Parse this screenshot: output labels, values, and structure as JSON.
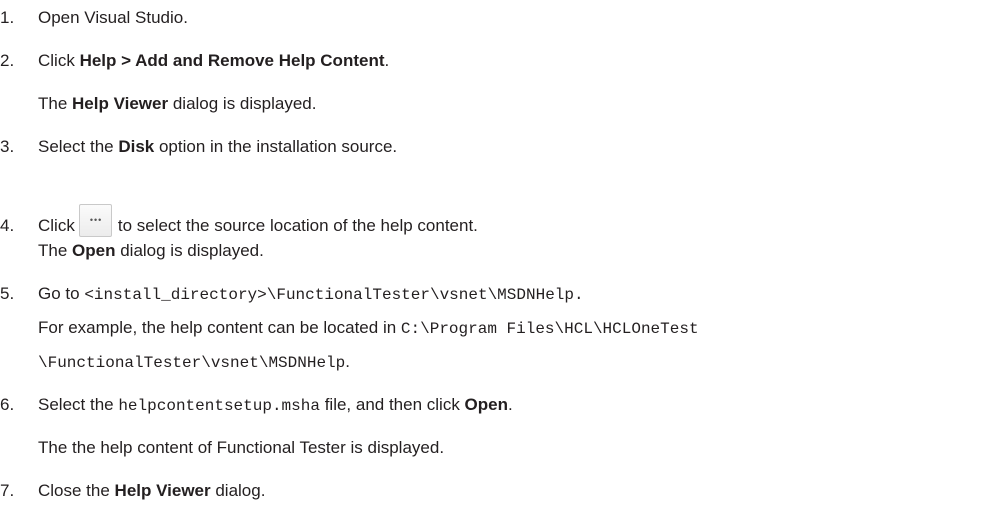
{
  "steps": {
    "s1": {
      "num": "1.",
      "text": "Open Visual Studio."
    },
    "s2": {
      "num": "2.",
      "pre": "Click ",
      "bold": "Help > Add and Remove Help Content",
      "post": "."
    },
    "s2_result": {
      "bold": "Help Viewer",
      "post": " dialog is displayed.",
      "pre": "The "
    },
    "s3": {
      "num": "3.",
      "pre": "Select the ",
      "bold": "Disk",
      "post": " option in the installation source."
    },
    "s4": {
      "num": "4.",
      "pre": "Click",
      "post": "to select the source location of the help content.",
      "icon": "browse-ellipsis-icon"
    },
    "s4_result": {
      "pre": "The ",
      "bold": "Open",
      "post": " dialog is displayed."
    },
    "s5": {
      "num": "5.",
      "pre": "Go to ",
      "code": "<install_directory>\\FunctionalTester\\vsnet\\MSDNHelp."
    },
    "s5_example1": {
      "pre": "For example, the help content can be located in ",
      "code": "C:\\Program Files\\HCL\\HCLOneTest"
    },
    "s5_example2": {
      "code": "\\FunctionalTester\\vsnet\\MSDNHelp",
      "post": "."
    },
    "s6": {
      "num": "6.",
      "pre": "Select the ",
      "code": "helpcontentsetup.msha",
      "mid": " file, and then click ",
      "bold": "Open",
      "post": "."
    },
    "s6_result": {
      "text": "The the help content of Functional Tester is displayed."
    },
    "s7": {
      "num": "7.",
      "pre": "Close the ",
      "bold": "Help Viewer",
      "post": " dialog."
    }
  }
}
